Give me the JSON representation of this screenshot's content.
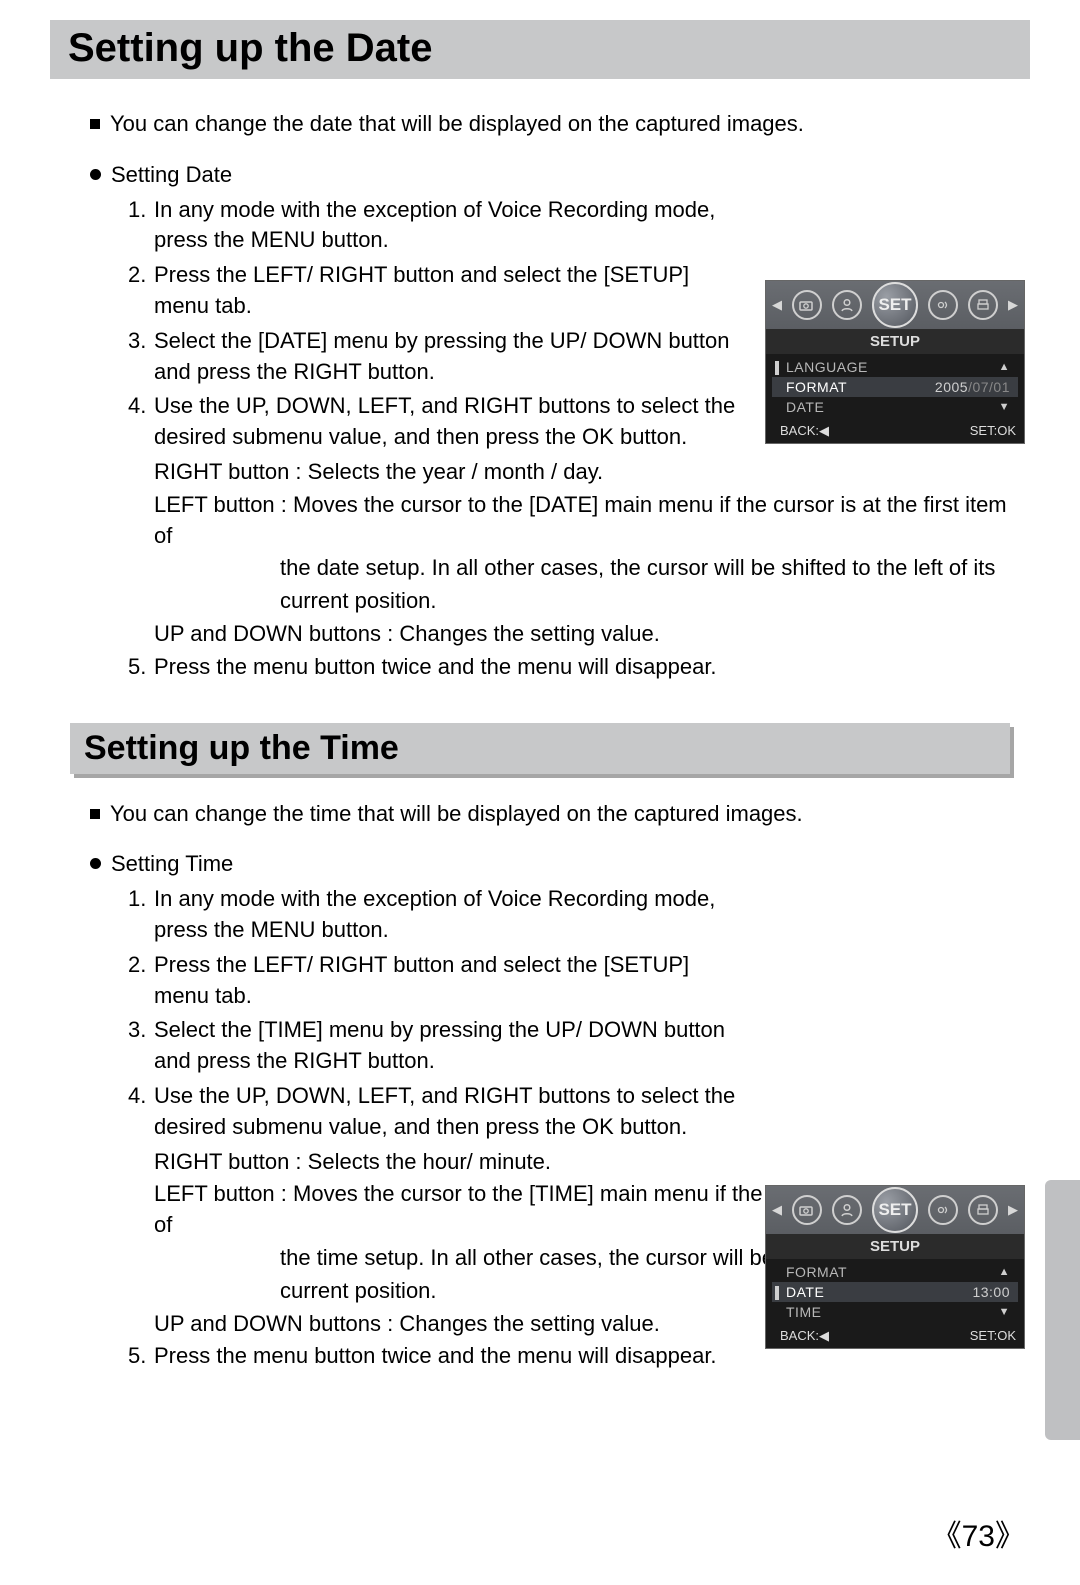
{
  "title_main": "Setting up the Date",
  "intro_date": "You can change the date that will be displayed on the captured images.",
  "subtitle_date": "Setting Date",
  "steps_date": {
    "s1": "In any mode with the exception of Voice Recording mode, press the MENU button.",
    "s2": "Press the LEFT/ RIGHT button and select the [SETUP] menu tab.",
    "s3": "Select the [DATE] menu by pressing the UP/ DOWN button and press the RIGHT button.",
    "s4a": "Use the UP, DOWN, LEFT, and RIGHT buttons to select the desired submenu value, and then press the OK button.",
    "s4_right": "RIGHT button : Selects the year / month / day.",
    "s4_left1": "LEFT button : Moves the cursor to the [DATE] main menu if the cursor is at the first item of",
    "s4_left2": "the date setup. In all other cases, the cursor will be shifted to the left of its",
    "s4_left3": "current position.",
    "s4_updown": "UP and DOWN buttons : Changes the setting value.",
    "s5": "Press the menu button twice and the menu will disappear."
  },
  "title_time_heading": "Setting up the Time",
  "intro_time": "You can change the time that will be displayed on the captured images.",
  "subtitle_time": "Setting Time",
  "steps_time": {
    "s1": "In any mode with the exception of Voice Recording mode, press the MENU button.",
    "s2": "Press the LEFT/ RIGHT button and select the [SETUP] menu tab.",
    "s3": "Select the [TIME] menu by pressing the UP/ DOWN button and press the RIGHT button.",
    "s4a": "Use the UP, DOWN, LEFT, and RIGHT buttons to select the desired submenu value, and then press the OK button.",
    "s4_right": "RIGHT button : Selects the hour/ minute.",
    "s4_left1": "LEFT button : Moves the cursor to the [TIME] main menu if the cursor is at the first item of",
    "s4_left2": "the time setup. In all other cases, the cursor will be shifted to the left of its",
    "s4_left3": "current position.",
    "s4_updown": "UP and DOWN buttons : Changes the setting value.",
    "s5": "Press the menu button twice and the menu will disappear."
  },
  "lcd": {
    "set_label": "SET",
    "setup_label": "SETUP",
    "back_label": "BACK:◀",
    "ok_label": "SET:OK",
    "date_menu": {
      "r1": "LANGUAGE",
      "r2": "FORMAT",
      "r2_val_y": "2005",
      "r2_val_md": "/07/01",
      "r3": "DATE"
    },
    "time_menu": {
      "r1": "FORMAT",
      "r2": "DATE",
      "r2_val": "13:00",
      "r3": "TIME"
    }
  },
  "page_number": "73"
}
